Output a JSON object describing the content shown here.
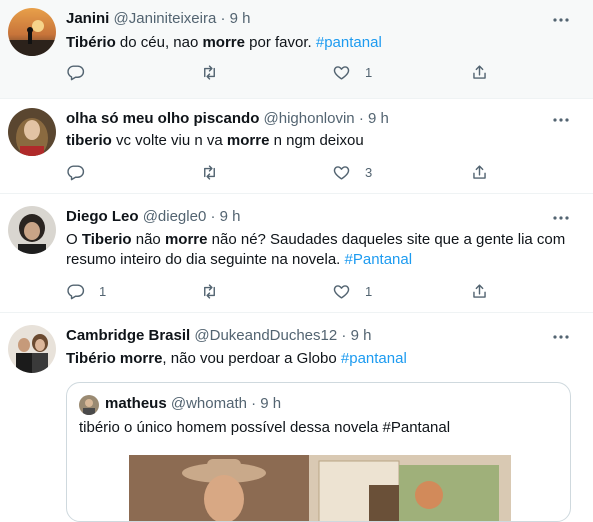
{
  "colors": {
    "accent": "#1d9bf0",
    "text": "#0f1419",
    "muted": "#536471",
    "highlight_bg": "#f7f9f9"
  },
  "tweets": [
    {
      "name": "Janini",
      "handle": "@Janiniteixeira",
      "dot": "·",
      "time": "9 h",
      "text": {
        "p1": "Tibério",
        "p2": " do céu, nao ",
        "p3": "morre",
        "p4": " por favor. ",
        "tag": "#pantanal"
      },
      "counts": {
        "reply": "",
        "retweet": "",
        "like": "1"
      }
    },
    {
      "name": "olha só meu olho piscando",
      "handle": "@highonlovin",
      "dot": "·",
      "time": "9 h",
      "text": {
        "p1": "tiberio",
        "p2": " vc volte viu n va ",
        "p3": "morre",
        "p4": " n ngm deixou"
      },
      "counts": {
        "reply": "",
        "retweet": "",
        "like": "3"
      }
    },
    {
      "name": "Diego Leo",
      "handle": "@diegle0",
      "dot": "·",
      "time": "9 h",
      "text": {
        "p0": "O ",
        "p1": "Tiberio",
        "p2": " não ",
        "p3": "morre",
        "p4": " não né? Saudades daqueles site que a gente lia com",
        "line2": "resumo inteiro do dia seguinte na novela. ",
        "tag": "#Pantanal"
      },
      "counts": {
        "reply": "1",
        "retweet": "",
        "like": "1"
      }
    },
    {
      "name": "Cambridge Brasil",
      "handle": "@DukeandDuches12",
      "dot": "·",
      "time": "9 h",
      "text": {
        "p1": "Tibério morre",
        "p2": ", não vou perdoar a Globo ",
        "tag": "#pantanal"
      },
      "quote": {
        "name": "matheus",
        "handle": "@whomath",
        "dot": "·",
        "time": "9 h",
        "text": "tibério o único homem possível dessa novela #Pantanal"
      }
    }
  ]
}
